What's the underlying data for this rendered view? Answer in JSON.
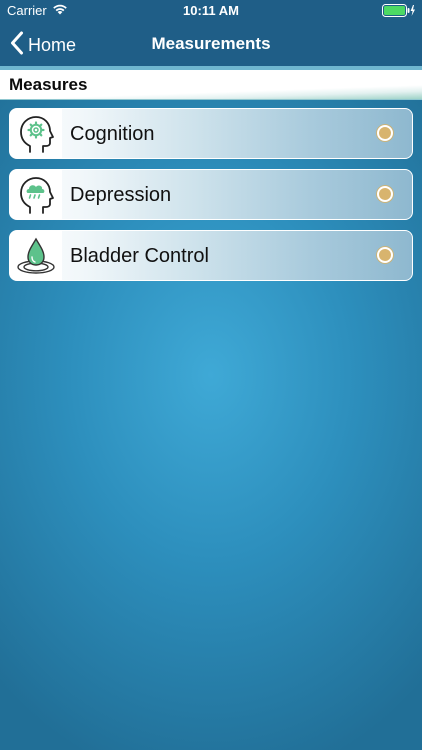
{
  "status_bar": {
    "carrier": "Carrier",
    "time": "10:11 AM",
    "wifi_icon": "wifi-icon",
    "battery_icon": "battery-icon",
    "battery_color": "#4cd964"
  },
  "nav": {
    "back_label": "Home",
    "back_icon": "chevron-left-icon",
    "title": "Measurements",
    "bar_color": "#1f5e87"
  },
  "section": {
    "title": "Measures"
  },
  "measures": [
    {
      "label": "Cognition",
      "icon": "head-gear-icon",
      "selected": false
    },
    {
      "label": "Depression",
      "icon": "head-cloud-icon",
      "selected": false
    },
    {
      "label": "Bladder Control",
      "icon": "water-drop-icon",
      "selected": false
    }
  ],
  "colors": {
    "accent_green": "#5dc28b",
    "radio_fill": "#d8b46e",
    "background": "#2d8fbd"
  }
}
